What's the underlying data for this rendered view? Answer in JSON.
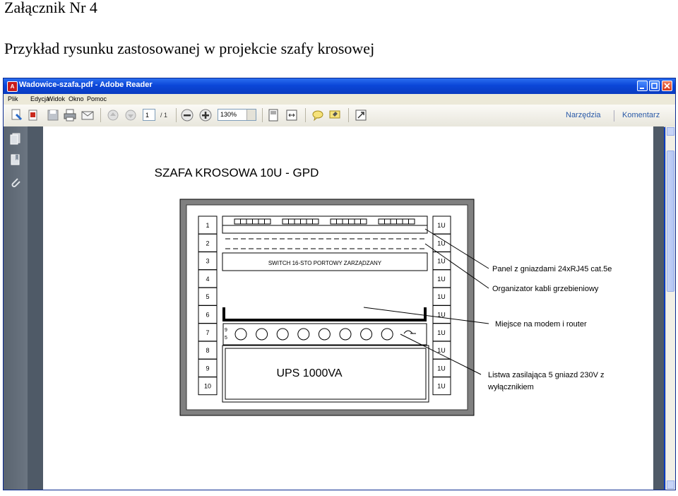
{
  "document": {
    "heading": "Załącznik Nr 4",
    "subheading": "Przykład rysunku zastosowanej w projekcie szafy krosowej"
  },
  "window": {
    "title": "Wadowice-szafa.pdf - Adobe Reader",
    "menu": [
      "Plik",
      "Edycja",
      "Widok",
      "Okno",
      "Pomoc"
    ]
  },
  "toolbar": {
    "page_current": "1",
    "page_total": "/ 1",
    "zoom": "130%",
    "tools_label": "Narzędzia",
    "comment_label": "Komentarz",
    "icons": [
      "create-pdf-icon",
      "open-icon",
      "save-icon",
      "print-icon",
      "email-icon",
      "prev-page-icon",
      "next-page-icon",
      "zoom-out-icon",
      "zoom-in-icon",
      "fit-page-icon",
      "fit-width-icon",
      "comment-icon",
      "highlight-icon",
      "fullscreen-icon"
    ]
  },
  "sidebar": {
    "icons": [
      "pages-icon",
      "bookmarks-icon",
      "attachments-icon"
    ]
  },
  "diagram": {
    "title": "SZAFA KROSOWA 10U - GPD",
    "rows": [
      "1",
      "2",
      "3",
      "4",
      "5",
      "6",
      "7",
      "8",
      "9",
      "10"
    ],
    "unit_label": "1U",
    "switch_label": "SWITCH 16-STO PORTOWY ZARZĄDZANY",
    "ups_label": "UPS 1000VA",
    "annotations": [
      "Panel z gniazdami 24xRJ45 cat.5e",
      "Organizator kabli grzebieniowy",
      "Miejsce na modem i router",
      "Listwa zasilająca 5 gniazd 230V z",
      "wyłącznikiem"
    ]
  }
}
